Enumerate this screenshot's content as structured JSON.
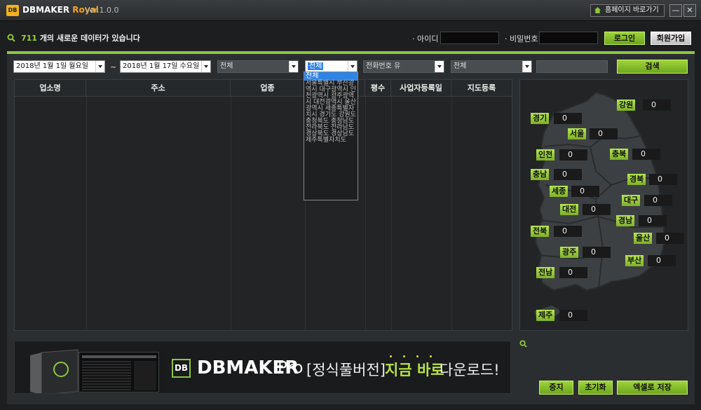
{
  "titlebar": {
    "logo_badge": "DB",
    "title_main": "DBMAKER",
    "title_accent": "Royal",
    "version": "Ver.1.0.0",
    "homepage_label": "홈페이지 바로가기",
    "minimize": "—",
    "close": "✕"
  },
  "info": {
    "count": "711",
    "notice": "개의 새로운 데이터가 있습니다",
    "id_label": "· 아이디",
    "pw_label": "· 비밀번호",
    "login": "로그인",
    "signup": "회원가입"
  },
  "filters": {
    "date_from": "2018년  1월  1일 월요일",
    "tilde": "~",
    "date_to": "2018년  1월 17일 수요일",
    "filter1": "전체",
    "region": "전체",
    "phone": "전화번호 유",
    "filter4": "전체",
    "search": "검색"
  },
  "table": {
    "headers": [
      "업소명",
      "주소",
      "업종",
      "평수",
      "사업자등록일",
      "지도등록"
    ]
  },
  "dropdown": {
    "selected": "전체",
    "items_text": "서울특별시 부산광역시 대구광역시 인천광역시 광주광역시 대전광역시 울산광역시 세종특별자치시 경기도 강원도 충청북도 충청남도 전라북도 전라남도 경상북도 경상남도 제주특별자치도"
  },
  "map": {
    "regions": [
      {
        "name": "강원",
        "value": "0"
      },
      {
        "name": "경기",
        "value": "0"
      },
      {
        "name": "서울",
        "value": "0"
      },
      {
        "name": "인천",
        "value": "0"
      },
      {
        "name": "충북",
        "value": "0"
      },
      {
        "name": "충남",
        "value": "0"
      },
      {
        "name": "경북",
        "value": "0"
      },
      {
        "name": "세종",
        "value": "0"
      },
      {
        "name": "대구",
        "value": "0"
      },
      {
        "name": "대전",
        "value": "0"
      },
      {
        "name": "경남",
        "value": "0"
      },
      {
        "name": "전북",
        "value": "0"
      },
      {
        "name": "울산",
        "value": "0"
      },
      {
        "name": "광주",
        "value": "0"
      },
      {
        "name": "부산",
        "value": "0"
      },
      {
        "name": "전남",
        "value": "0"
      },
      {
        "name": "제주",
        "value": "0"
      }
    ]
  },
  "banner": {
    "badge": "DB",
    "brand": "DBMAKER",
    "pro": "Pro",
    "full_version": "[정식풀버전]",
    "now": "지금 바로",
    "download": "다운로드!"
  },
  "actions": {
    "stop": "중지",
    "reset": "초기화",
    "excel": "엑셀로 저장"
  },
  "colors": {
    "accent": "#8dc63f",
    "brand_orange": "#f2a41b",
    "selection_blue": "#2f84e6"
  }
}
